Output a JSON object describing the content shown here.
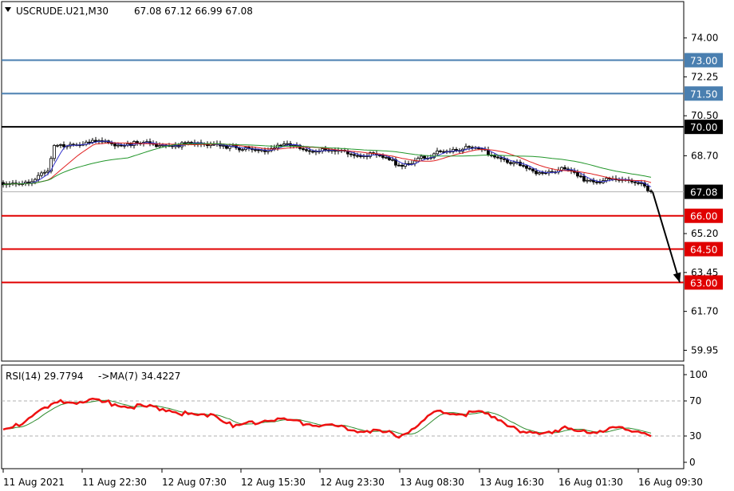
{
  "header": {
    "symbol": "USCRUDE.U21,M30",
    "ohlc": "67.08 67.12 66.99 67.08"
  },
  "rsi_header": {
    "label": "RSI(14) 29.7794",
    "ma_label": "->MA(7) 34.4227"
  },
  "colors": {
    "blue_level": "#4a7fb0",
    "red_level": "#e00000",
    "black_level": "#000000",
    "ma_fast": "#3333cc",
    "ma_mid": "#e02020",
    "ma_slow": "#22962a",
    "rsi_line": "#ee1111",
    "rsi_ma": "#2e8b2e",
    "arrow": "#000000"
  },
  "chart_data": [
    {
      "type": "candlestick",
      "title": "USCRUDE.U21,M30",
      "ylim": [
        59.5,
        75.6
      ],
      "y_ticks": [
        "74.00",
        "72.25",
        "70.50",
        "68.70",
        "65.20",
        "63.45",
        "61.70",
        "59.95"
      ],
      "x_tick_labels": [
        "11 Aug 2021",
        "11 Aug 22:30",
        "12 Aug 07:30",
        "12 Aug 15:30",
        "12 Aug 23:30",
        "13 Aug 08:30",
        "13 Aug 16:30",
        "16 Aug 01:30",
        "16 Aug 09:30"
      ],
      "current_price": 67.08,
      "current_price_label": "67.08",
      "levels": [
        {
          "value": 73.0,
          "label": "73.00",
          "kind": "resistance-blue"
        },
        {
          "value": 71.5,
          "label": "71.50",
          "kind": "resistance-blue"
        },
        {
          "value": 70.0,
          "label": "70.00",
          "kind": "resistance-black"
        },
        {
          "value": 66.0,
          "label": "66.00",
          "kind": "support-red"
        },
        {
          "value": 64.5,
          "label": "64.50",
          "kind": "support-red"
        },
        {
          "value": 63.0,
          "label": "63.00",
          "kind": "support-red"
        }
      ],
      "close_anchors": [
        [
          0,
          67.3
        ],
        [
          5,
          67.5
        ],
        [
          10,
          67.65
        ],
        [
          14,
          68.0
        ],
        [
          16,
          69.1
        ],
        [
          22,
          69.3
        ],
        [
          40,
          69.25
        ],
        [
          60,
          69.2
        ],
        [
          66,
          69.3
        ],
        [
          74,
          68.95
        ],
        [
          82,
          69.0
        ],
        [
          88,
          69.15
        ],
        [
          100,
          68.9
        ],
        [
          115,
          68.75
        ],
        [
          125,
          68.3
        ],
        [
          130,
          68.55
        ],
        [
          134,
          68.6
        ],
        [
          138,
          69.0
        ],
        [
          148,
          69.0
        ],
        [
          152,
          68.85
        ],
        [
          158,
          68.5
        ],
        [
          166,
          68.0
        ],
        [
          176,
          68.1
        ],
        [
          182,
          67.6
        ],
        [
          195,
          67.6
        ],
        [
          200,
          67.5
        ],
        [
          203,
          67.08
        ]
      ],
      "moving_averages": [
        {
          "name": "fast",
          "period": 5
        },
        {
          "name": "mid",
          "period": 14
        },
        {
          "name": "slow",
          "period": 40
        }
      ],
      "forecast_arrow": {
        "from": 67.08,
        "to": 63.0
      }
    },
    {
      "type": "line",
      "title": "RSI(14) 29.7794",
      "ylim": [
        0,
        100
      ],
      "y_ticks": [
        "100",
        "70",
        "30",
        "0"
      ],
      "dashed_levels": [
        70,
        30
      ],
      "rsi_anchors": [
        [
          0,
          35
        ],
        [
          6,
          44
        ],
        [
          10,
          57
        ],
        [
          14,
          62
        ],
        [
          18,
          68
        ],
        [
          28,
          70
        ],
        [
          40,
          64
        ],
        [
          50,
          62
        ],
        [
          60,
          52
        ],
        [
          66,
          56
        ],
        [
          72,
          40
        ],
        [
          82,
          49
        ],
        [
          90,
          47
        ],
        [
          98,
          43
        ],
        [
          108,
          38
        ],
        [
          118,
          35
        ],
        [
          124,
          31
        ],
        [
          130,
          42
        ],
        [
          136,
          58
        ],
        [
          142,
          55
        ],
        [
          150,
          56
        ],
        [
          156,
          50
        ],
        [
          162,
          32
        ],
        [
          168,
          34
        ],
        [
          176,
          38
        ],
        [
          182,
          34
        ],
        [
          192,
          38
        ],
        [
          200,
          35
        ],
        [
          203,
          29.8
        ]
      ],
      "rsi_value": 29.7794,
      "ma_value": 34.4227
    }
  ]
}
